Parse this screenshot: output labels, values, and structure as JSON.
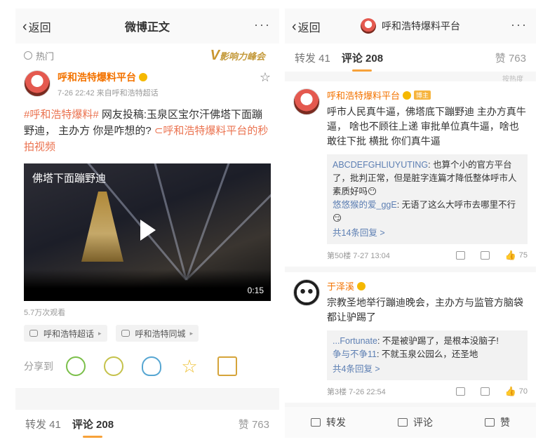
{
  "left": {
    "nav": {
      "back": "返回",
      "title": "微博正文",
      "more": "···"
    },
    "hot": "热门",
    "watermark": "影响力峰会",
    "author": {
      "name": "呼和浩特爆料平台",
      "meta": "7-26 22:42  来自呼和浩特超话"
    },
    "post": {
      "tag": "#呼和浩特爆料#",
      "text": " 网友投稿:玉泉区宝尔汗佛塔下面蹦野迪， 主办方 你是咋想的? ",
      "link": "⊂呼和浩特爆料平台的秒拍视频"
    },
    "video": {
      "title": "佛塔下面蹦野迪",
      "duration": "0:15"
    },
    "views": "5.7万次观看",
    "chips": [
      "呼和浩特超话",
      "呼和浩特同城"
    ],
    "share_label": "分享到",
    "tabs": {
      "repost": "转发 41",
      "comment": "评论 208",
      "like": "赞 763"
    }
  },
  "right": {
    "nav": {
      "back": "返回",
      "title": "呼和浩特爆料平台",
      "more": "···"
    },
    "tabs": {
      "repost": "转发 41",
      "comment": "评论 208",
      "like": "赞 763"
    },
    "scroll_hint": "按热度",
    "comments": [
      {
        "name": "呼和浩特爆料平台",
        "badge": "博主",
        "text": "呼市人民真牛逼，佛塔底下蹦野迪   主办方真牛逼，   啥也不顾往上递  审批单位真牛逼，啥也敢往下批          横批 你们真牛逼",
        "replies": [
          {
            "user": "ABCDEFGHLIUYUTING",
            "text": ": 也算个小的官方平台了，批判正常，但是脏字连篇才降低整体呼市人素质好吗😶"
          },
          {
            "user": "悠悠猴的爱_ggE",
            "text": ": 无语了这么大呼市去哪里不行😏"
          }
        ],
        "more": "共14条回复 >",
        "floor": "第50楼  7-27 13:04",
        "likes": "75"
      },
      {
        "name": "于泽溪",
        "text": "宗教圣地举行蹦迪晚会，主办方与监管方脑袋都让驴踢了",
        "replies": [
          {
            "user": "...Fortunate",
            "text": ": 不是被驴踢了，是根本没脑子!"
          },
          {
            "user": "争与不争11",
            "text": ": 不就玉泉公园么，还圣地"
          }
        ],
        "more": "共4条回复 >",
        "floor": "第3楼  7-26 22:54",
        "likes": "70"
      }
    ],
    "bottom": {
      "repost": "转发",
      "comment": "评论",
      "like": "赞"
    }
  }
}
